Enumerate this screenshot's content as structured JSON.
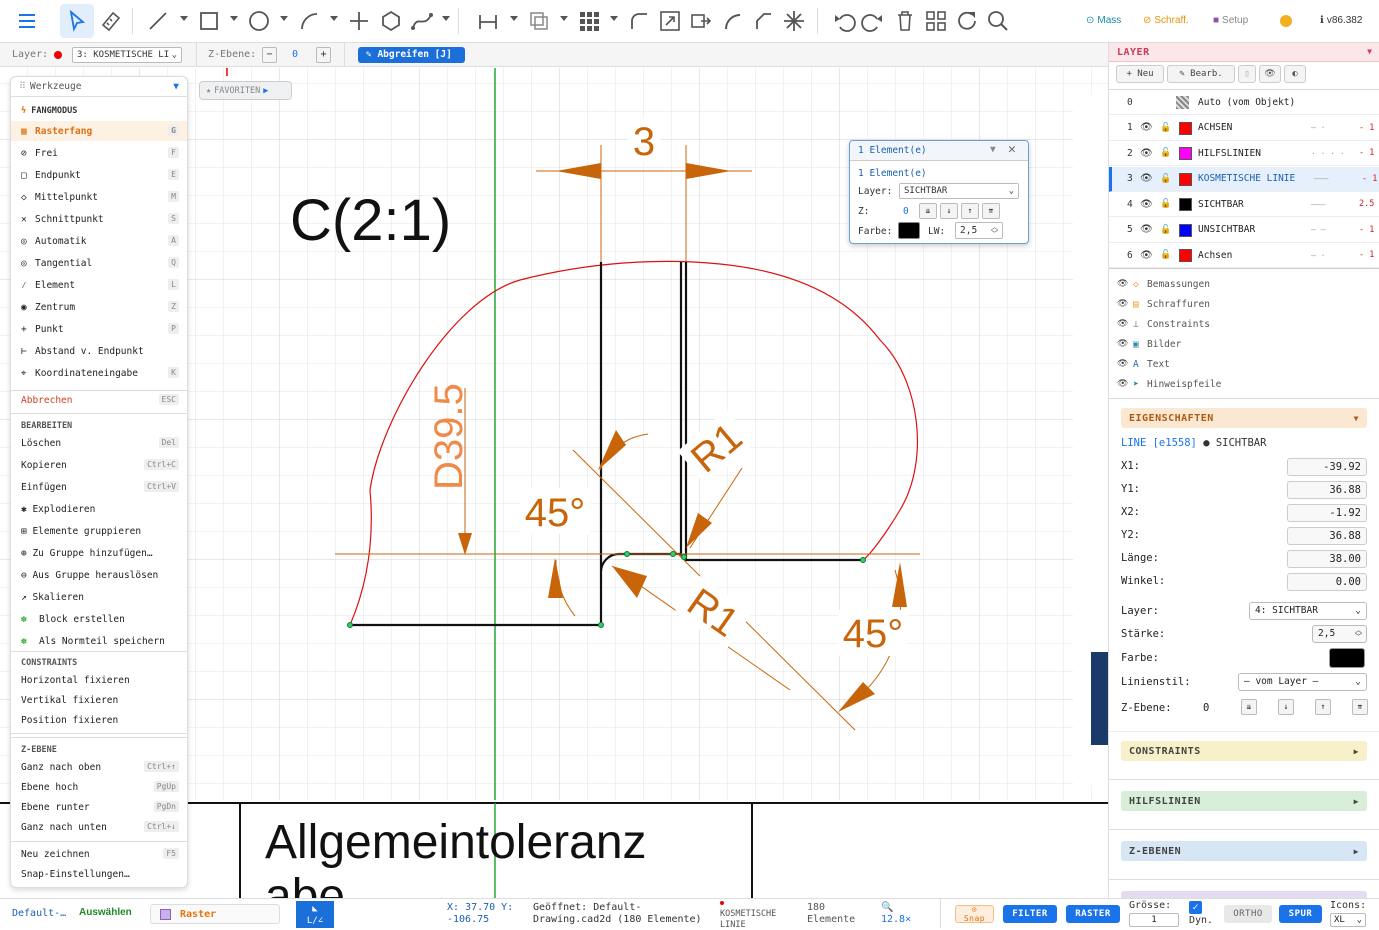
{
  "toolbar": {
    "right": {
      "mass": "Mass",
      "schraff": "Schraff.",
      "setup": "Setup",
      "version": "v86.382"
    }
  },
  "optbar": {
    "layer_label": "Layer:",
    "layer_value": "3: KOSMETISCHE LI",
    "zebene_label": "Z-Ebene:",
    "minus": "−",
    "zvalue": "0",
    "plus": "+",
    "abgreifen": "Abgreifen [J]"
  },
  "drawing": {
    "title": "C(2:1)",
    "dim_top": "3",
    "dim_d": "D39.5",
    "angle_left": "45°",
    "angle_right": "45°",
    "radius_top": "R1",
    "radius_bottom": "R1",
    "titleblock_text1": "Allgemeintoleranz",
    "titleblock_text2": "abe"
  },
  "favoriten": "FAVORITEN",
  "tools": {
    "header": "Werkzeuge",
    "fangmodus_title": "FANGMODUS",
    "snap": [
      {
        "icon": "▦",
        "label": "Rasterfang",
        "key": "G"
      },
      {
        "icon": "⊘",
        "label": "Frei",
        "key": "F"
      },
      {
        "icon": "□",
        "label": "Endpunkt",
        "key": "E"
      },
      {
        "icon": "◇",
        "label": "Mittelpunkt",
        "key": "M"
      },
      {
        "icon": "✕",
        "label": "Schnittpunkt",
        "key": "S"
      },
      {
        "icon": "◎",
        "label": "Automatik",
        "key": "A"
      },
      {
        "icon": "◎",
        "label": "Tangential",
        "key": "Q"
      },
      {
        "icon": "⁄",
        "label": "Element",
        "key": "L"
      },
      {
        "icon": "◉",
        "label": "Zentrum",
        "key": "Z"
      },
      {
        "icon": "+",
        "label": "Punkt",
        "key": "P"
      },
      {
        "icon": "⊢",
        "label": "Abstand v. Endpunkt",
        "key": ""
      },
      {
        "icon": "⌖",
        "label": "Koordinateneingabe",
        "key": "K"
      }
    ],
    "abbrechen": "Abbrechen",
    "abbrechen_key": "ESC",
    "bearbeiten_title": "BEARBEITEN",
    "edit": [
      {
        "label": "Löschen",
        "key": "Del"
      },
      {
        "label": "Kopieren",
        "key": "Ctrl+C"
      },
      {
        "label": "Einfügen",
        "key": "Ctrl+V"
      },
      {
        "label": "✱ Explodieren",
        "key": ""
      },
      {
        "label": "⊞ Elemente gruppieren",
        "key": ""
      },
      {
        "label": "⊕ Zu Gruppe hinzufügen…",
        "key": ""
      },
      {
        "label": "⊖ Aus Gruppe herauslösen",
        "key": ""
      },
      {
        "label": "↗ Skalieren",
        "key": ""
      },
      {
        "label": "Block erstellen",
        "key": ""
      },
      {
        "label": "Als Normteil speichern",
        "key": ""
      }
    ],
    "constraints_title": "CONSTRAINTS",
    "constraints": [
      "Horizontal fixieren",
      "Vertikal fixieren",
      "Position fixieren"
    ],
    "zebene_title": "Z-EBENE",
    "zebene": [
      {
        "label": "Ganz nach oben",
        "key": "Ctrl+↑"
      },
      {
        "label": "Ebene hoch",
        "key": "PgUp"
      },
      {
        "label": "Ebene runter",
        "key": "PgDn"
      },
      {
        "label": "Ganz nach unten",
        "key": "Ctrl+↓"
      }
    ],
    "neu_zeichnen": "Neu zeichnen",
    "neu_key": "F5",
    "snap_settings": "Snap-Einstellungen…"
  },
  "popup": {
    "title": "1 Element(e)",
    "count": "1 Element(e)",
    "layer_label": "Layer:",
    "layer_value": "SICHTBAR",
    "z_label": "Z:",
    "z_value": "0",
    "farbe_label": "Farbe:",
    "lw_label": "LW:",
    "lw_value": "2,5",
    "z_btns": [
      "⇊",
      "↓",
      "↑",
      "⇈"
    ]
  },
  "layer_panel": {
    "title": "LAYER",
    "btn_new": "+ Neu",
    "btn_edit": "✎ Bearb.",
    "layers": [
      {
        "num": "0",
        "name": "Auto (vom Objekt)",
        "color": "",
        "style": "",
        "w": ""
      },
      {
        "num": "1",
        "name": "ACHSEN",
        "color": "#ff0000",
        "style": "— ·",
        "w": "- 1"
      },
      {
        "num": "2",
        "name": "HILFSLINIEN",
        "color": "#ff00ff",
        "style": "· · · ·",
        "w": "- 1"
      },
      {
        "num": "3",
        "name": "KOSMETISCHE LINIE",
        "color": "#ff0000",
        "style": "———",
        "w": "- 1"
      },
      {
        "num": "4",
        "name": "SICHTBAR",
        "color": "#000000",
        "style": "———",
        "w": "2.5"
      },
      {
        "num": "5",
        "name": "UNSICHTBAR",
        "color": "#0000ff",
        "style": "— —",
        "w": "- 1"
      },
      {
        "num": "6",
        "name": "Achsen",
        "color": "#ff0000",
        "style": "— ·",
        "w": "- 1"
      }
    ],
    "categories": [
      {
        "icon": "◇",
        "label": "Bemassungen",
        "color": "#e8a020"
      },
      {
        "icon": "▤",
        "label": "Schraffuren",
        "color": "#e8a020"
      },
      {
        "icon": "⊥",
        "label": "Constraints",
        "color": "#888888"
      },
      {
        "icon": "▣",
        "label": "Bilder",
        "color": "#2a8ab0"
      },
      {
        "icon": "A",
        "label": "Text",
        "color": "#2a6ab0"
      },
      {
        "icon": "➤",
        "label": "Hinweispfeile",
        "color": "#1a7ab0"
      }
    ]
  },
  "properties": {
    "title": "EIGENSCHAFTEN",
    "entity": "LINE [e1558]",
    "entity_layer": "● SICHTBAR",
    "fields": [
      {
        "label": "X1:",
        "value": "-39.92"
      },
      {
        "label": "Y1:",
        "value": "36.88"
      },
      {
        "label": "X2:",
        "value": "-1.92"
      },
      {
        "label": "Y2:",
        "value": "36.88"
      },
      {
        "label": "Länge:",
        "value": "38.00"
      },
      {
        "label": "Winkel:",
        "value": "0.00"
      }
    ],
    "layer_label": "Layer:",
    "layer_value": "4: SICHTBAR",
    "staerke_label": "Stärke:",
    "staerke_value": "2,5",
    "farbe_label": "Farbe:",
    "linienstil_label": "Linienstil:",
    "linienstil_value": "— vom Layer —",
    "zebene_label": "Z-Ebene:",
    "zebene_value": "0",
    "z_btns": [
      "⇊",
      "↓",
      "↑",
      "⇈"
    ]
  },
  "sections": {
    "constraints": "CONSTRAINTS",
    "hilfslinien": "HILFSLINIEN",
    "zebenen": "Z-EBENEN"
  },
  "status": {
    "file": "Default-…",
    "mode": "Auswählen",
    "raster": "Raster",
    "coords_x": "X: 37.70 Y:",
    "coords_y": "-106.75",
    "opened_1": "Geöffnet: Default-",
    "opened_2": "Drawing.cad2d (180 Elemente)",
    "layer_1": "KOSMETISCHE",
    "layer_2": "LINIE",
    "count_1": "180",
    "count_2": "Elemente",
    "zoom": "12.8×",
    "snap": "Snap",
    "filter": "FILTER",
    "raster_btn": "RASTER",
    "groesse": "Grösse:",
    "groesse_val": "1",
    "dyn": "Dyn.",
    "ortho": "ORTHO",
    "spur": "SPUR",
    "icons": "Icons:",
    "icons_val": "XL"
  }
}
